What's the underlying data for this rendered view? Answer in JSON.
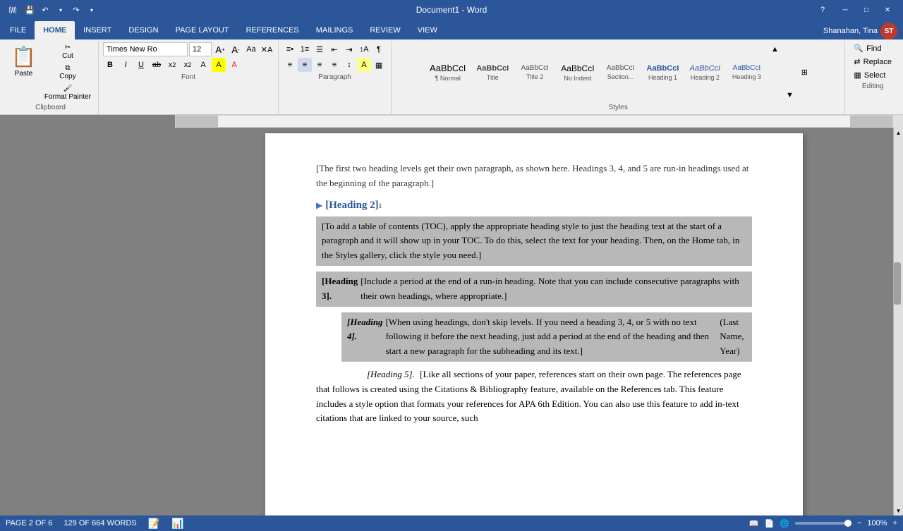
{
  "titleBar": {
    "title": "Document1 - Word",
    "minimize": "─",
    "maximize": "□",
    "close": "✕",
    "helpIcon": "?",
    "quickAccess": [
      "💾",
      "↶",
      "↷"
    ]
  },
  "tabs": [
    {
      "id": "file",
      "label": "FILE"
    },
    {
      "id": "home",
      "label": "HOME",
      "active": true
    },
    {
      "id": "insert",
      "label": "INSERT"
    },
    {
      "id": "design",
      "label": "DESIGN"
    },
    {
      "id": "pageLayout",
      "label": "PAGE LAYOUT"
    },
    {
      "id": "references",
      "label": "REFERENCES"
    },
    {
      "id": "mailings",
      "label": "MAILINGS"
    },
    {
      "id": "review",
      "label": "REVIEW"
    },
    {
      "id": "view",
      "label": "VIEW"
    }
  ],
  "ribbon": {
    "clipboard": {
      "label": "Clipboard",
      "paste": "Paste",
      "cut": "Cut",
      "copy": "Copy",
      "formatPainter": "Format Painter"
    },
    "font": {
      "label": "Font",
      "fontName": "Times New Ro",
      "fontSize": "12",
      "grow": "A↑",
      "shrink": "A↓",
      "clearFormat": "A",
      "bold": "B",
      "italic": "I",
      "underline": "U",
      "strikethrough": "ab",
      "subscript": "x₂",
      "superscript": "x²",
      "fontColor": "A",
      "highlight": "🖌"
    },
    "paragraph": {
      "label": "Paragraph"
    },
    "styles": {
      "label": "Styles",
      "items": [
        {
          "preview": "AaBbCcI",
          "name": "¶ Normal"
        },
        {
          "preview": "AaBbCcI",
          "name": "Title"
        },
        {
          "preview": "AaBbCcI",
          "name": "Title 2"
        },
        {
          "preview": "AaBbCcI",
          "name": "No Indent"
        },
        {
          "preview": "AaBbCcI",
          "name": "Section..."
        },
        {
          "preview": "AaBbCcI",
          "name": "Heading 1"
        },
        {
          "preview": "AaBbCcI",
          "name": "Heading 2"
        },
        {
          "preview": "AaBbCcI",
          "name": "Heading 3"
        }
      ]
    },
    "editing": {
      "label": "Editing",
      "find": "Find",
      "replace": "Replace",
      "select": "Select"
    }
  },
  "document": {
    "introText": "[The first two heading levels get their own paragraph, as shown here.  Headings 3, 4, and 5 are run-in headings used at the beginning of the paragraph.]",
    "heading2": "[Heading 2]",
    "heading2Sup": "1",
    "toc_block": "[To add a table of contents (TOC), apply the appropriate heading style to just the heading text at the start of a paragraph and it will show up in your TOC.  To do this, select the text for your heading.  Then, on the Home tab, in the Styles gallery, click the style you need.]",
    "heading3": "[Heading 3].",
    "heading3_text": "[Include a period at the end of a run-in heading.  Note that you can include consecutive paragraphs with their own headings, where appropriate.]",
    "heading4": "[Heading 4].",
    "heading4_text": "[When using headings, don't skip levels.  If you need a heading 3, 4, or 5 with no text following it before the next heading, just add a period at the end of the heading and then start a new paragraph for the subheading and its text.]",
    "citation": "(Last Name, Year)",
    "heading5": "[Heading 5].",
    "heading5_text": "[Like all sections of your paper, references start on their own page.  The references page that follows is created using the Citations & Bibliography feature, available on the References tab.  This feature includes a style option that formats your references for APA 6th Edition.  You can also use this feature to add in-text citations that are linked to your source, such"
  },
  "statusBar": {
    "page": "PAGE 2 OF 6",
    "words": "129 OF 664 WORDS",
    "zoom": "100%",
    "zoomLevel": "100"
  },
  "user": {
    "name": "Shanahan, Tina",
    "initials": "ST"
  }
}
